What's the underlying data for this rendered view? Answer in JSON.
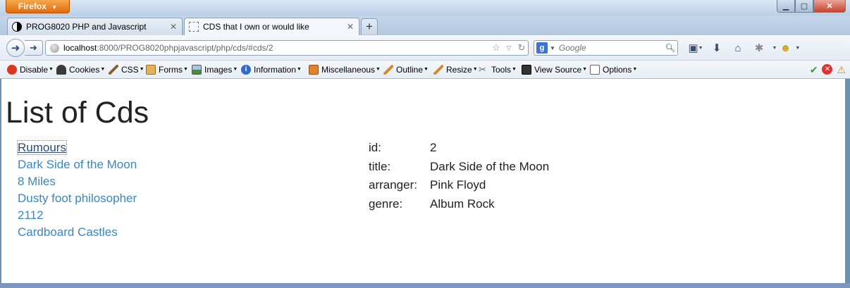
{
  "browser": {
    "firefox_button_label": "Firefox",
    "tabs": [
      {
        "title": "PROG8020 PHP and Javascript"
      },
      {
        "title": "CDS that I own or would like"
      }
    ],
    "new_tab_label": "+",
    "url_host": "localhost",
    "url_rest": ":8000/PROG8020phpjavascript/php/cds/#cds/2",
    "search_engine_letter": "g",
    "search_placeholder": "Google"
  },
  "devbar": {
    "items": [
      {
        "label": "Disable",
        "icon": "disable-icon",
        "color": "#d9371f"
      },
      {
        "label": "Cookies",
        "icon": "cookies-icon",
        "color": "#3a3a3a"
      },
      {
        "label": "CSS",
        "icon": "css-icon",
        "color": "#8a5f2b"
      },
      {
        "label": "Forms",
        "icon": "forms-icon",
        "color": "#c98a2e"
      },
      {
        "label": "Images",
        "icon": "images-icon",
        "color": "#4d8a3c"
      },
      {
        "label": "Information",
        "icon": "information-icon",
        "color": "#2f6bc9"
      },
      {
        "label": "Miscellaneous",
        "icon": "miscellaneous-icon",
        "color": "#c8641d"
      },
      {
        "label": "Outline",
        "icon": "outline-icon",
        "color": "#d5872b"
      },
      {
        "label": "Resize",
        "icon": "resize-icon",
        "color": "#d5872b"
      },
      {
        "label": "Tools",
        "icon": "tools-icon",
        "color": "#5a6b7a"
      },
      {
        "label": "View Source",
        "icon": "view-source-icon",
        "color": "#333333"
      },
      {
        "label": "Options",
        "icon": "options-icon",
        "color": "#666666"
      }
    ]
  },
  "page": {
    "heading": "List of Cds",
    "cds": [
      {
        "title": "Rumours",
        "active": true
      },
      {
        "title": "Dark Side of the Moon",
        "active": false
      },
      {
        "title": "8 Miles",
        "active": false
      },
      {
        "title": "Dusty foot philosopher",
        "active": false
      },
      {
        "title": "2112",
        "active": false
      },
      {
        "title": "Cardboard Castles",
        "active": false
      }
    ],
    "details": [
      {
        "label": "id:",
        "value": "2"
      },
      {
        "label": "title:",
        "value": "Dark Side of the Moon"
      },
      {
        "label": "arranger:",
        "value": "Pink Floyd"
      },
      {
        "label": "genre:",
        "value": "Album Rock"
      }
    ]
  },
  "colors": {
    "link": "#3a87c2",
    "active_link": "#2b4a73",
    "firefox_orange": "#e16b0e"
  }
}
